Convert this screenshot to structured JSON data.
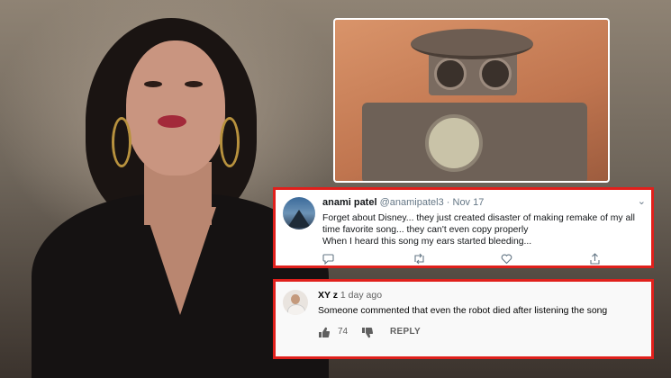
{
  "tweet": {
    "name": "anami patel",
    "handle": "@anamipatel3",
    "separator": "·",
    "date": "Nov 17",
    "lines": [
      "Forget about Disney... they just created disaster of making remake of my all",
      "time favorite song... they can't even copy properly",
      "When I heard this song my ears started bleeding..."
    ],
    "icons": {
      "menu": "chevron-down-icon",
      "reply": "reply-icon",
      "retweet": "retweet-icon",
      "like": "heart-icon",
      "share": "share-icon"
    }
  },
  "youtube_comment": {
    "name": "XY z",
    "time": "1 day ago",
    "text": "Someone commented that even the robot died after listening the song",
    "likes": "74",
    "reply_label": "REPLY",
    "icons": {
      "like": "thumbs-up-icon",
      "dislike": "thumbs-down-icon"
    }
  },
  "colors": {
    "highlight_border": "#e0201c",
    "twitter_meta": "#657786"
  }
}
